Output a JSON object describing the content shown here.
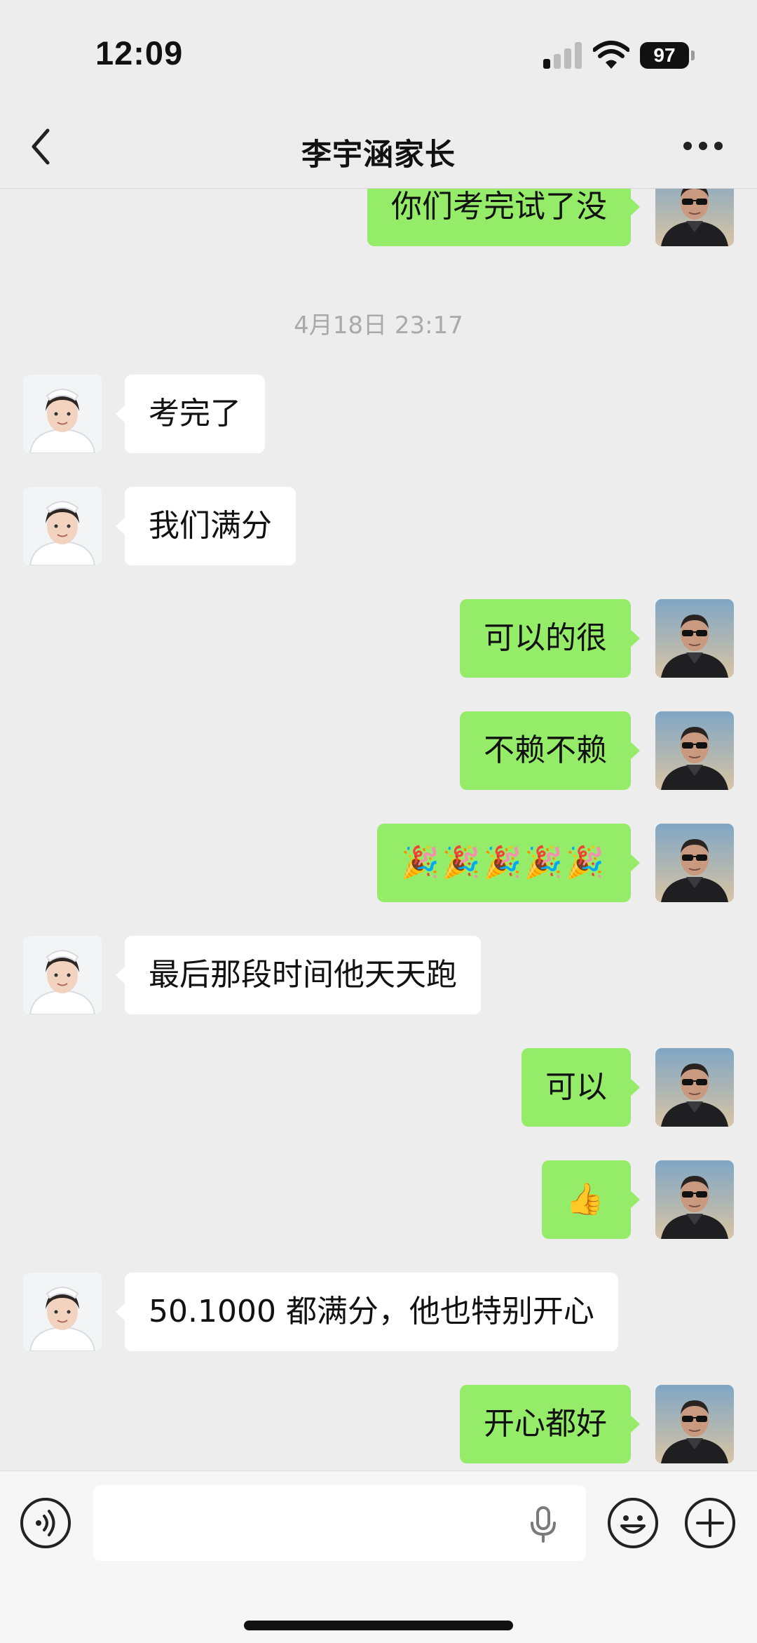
{
  "status_bar": {
    "time": "12:09",
    "battery": "97"
  },
  "header": {
    "title": "李宇涵家长"
  },
  "conversation": {
    "timestamp": "4月18日 23:17",
    "messages": [
      {
        "side": "right",
        "text": "你们考完试了没"
      },
      {
        "side": "left",
        "text": "考完了"
      },
      {
        "side": "left",
        "text": "我们满分"
      },
      {
        "side": "right",
        "text": "可以的很"
      },
      {
        "side": "right",
        "text": "不赖不赖"
      },
      {
        "side": "right",
        "text": "🎉🎉🎉🎉🎉"
      },
      {
        "side": "left",
        "text": "最后那段时间他天天跑"
      },
      {
        "side": "right",
        "text": "可以"
      },
      {
        "side": "right",
        "text": "👍"
      },
      {
        "side": "left",
        "text": "50.1000 都满分，他也特别开心"
      },
      {
        "side": "right",
        "text": "开心都好"
      }
    ]
  },
  "colors": {
    "sent_bubble": "#95ec69",
    "received_bubble": "#ffffff",
    "background": "#ededed"
  },
  "icons": {
    "back": "chevron-left-icon",
    "more": "more-dots-icon",
    "voice": "voice-mode-icon",
    "mic": "microphone-icon",
    "emoji": "emoji-face-icon",
    "plus": "plus-circle-icon"
  }
}
